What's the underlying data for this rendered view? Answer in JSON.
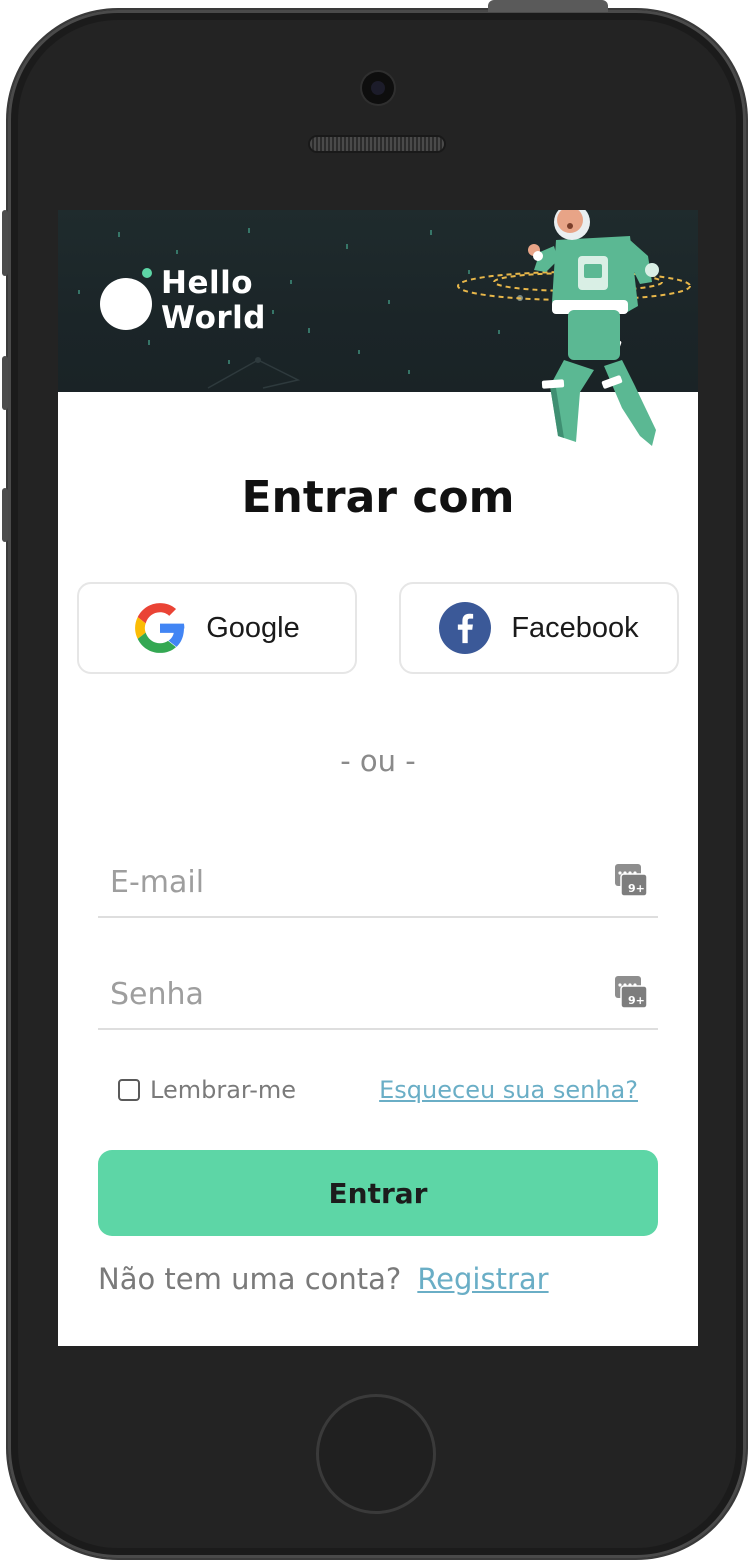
{
  "brand": {
    "line1": "Hello",
    "line2": "World",
    "accent_color": "#5dd6a6"
  },
  "login": {
    "title": "Entrar com",
    "google_label": "Google",
    "facebook_label": "Facebook",
    "divider": "- ou -",
    "email_placeholder": "E-mail",
    "password_placeholder": "Senha",
    "remember_label": "Lembrar-me",
    "forgot_link": "Esqueceu sua senha?",
    "submit_label": "Entrar",
    "no_account_text": "Não tem uma conta?",
    "register_link": "Registrar"
  },
  "icons": {
    "google": "google-icon",
    "facebook": "facebook-icon",
    "password_manager": "password-manager-icon",
    "astronaut": "astronaut-illustration"
  },
  "colors": {
    "hero_bg": "#1f2b2d",
    "primary_button": "#5dd6a6",
    "link": "#6aaec6",
    "facebook_blue": "#3b5998"
  }
}
